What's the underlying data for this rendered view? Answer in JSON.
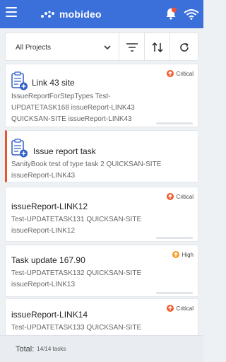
{
  "appbar": {
    "logo_text": "mobideo"
  },
  "filter": {
    "project_value": "All Projects"
  },
  "tasks": [
    {
      "title": "Link 43 site",
      "desc": "IssueReportForStepTypes Test-UPDATETASK168 issueReport-LINK43 QUICKSAN-SITE issueReport-LINK43",
      "priority": "Critical"
    },
    {
      "title": "Issue report task",
      "desc": "SanityBook test of type task 2 QUICKSAN-SITE issueReport-LINK43",
      "priority": ""
    },
    {
      "title": "issueReport-LINK12",
      "desc": "Test-UPDATETASK131 QUICKSAN-SITE issueReport-LINK12",
      "priority": "Critical"
    },
    {
      "title": "Task update 167.90",
      "desc": "Test-UPDATETASK132 QUICKSAN-SITE issueReport-LINK13",
      "priority": "High"
    },
    {
      "title": "issueReport-LINK14",
      "desc": "Test-UPDATETASK133 QUICKSAN-SITE",
      "priority": "Critical"
    }
  ],
  "footer": {
    "total_label": "Total:",
    "total_value": "14/14 tasks"
  },
  "colors": {
    "appbar": "#3b6fd9",
    "critical": "#ef5a2b",
    "high": "#f59b22",
    "active_border": "#e8542f"
  },
  "icons": [
    "menu-icon",
    "mobideo-logo",
    "bell-icon",
    "wifi-icon",
    "chevron-down-icon",
    "filter-icon",
    "sort-icon",
    "refresh-icon",
    "document-icon",
    "priority-up-icon"
  ]
}
